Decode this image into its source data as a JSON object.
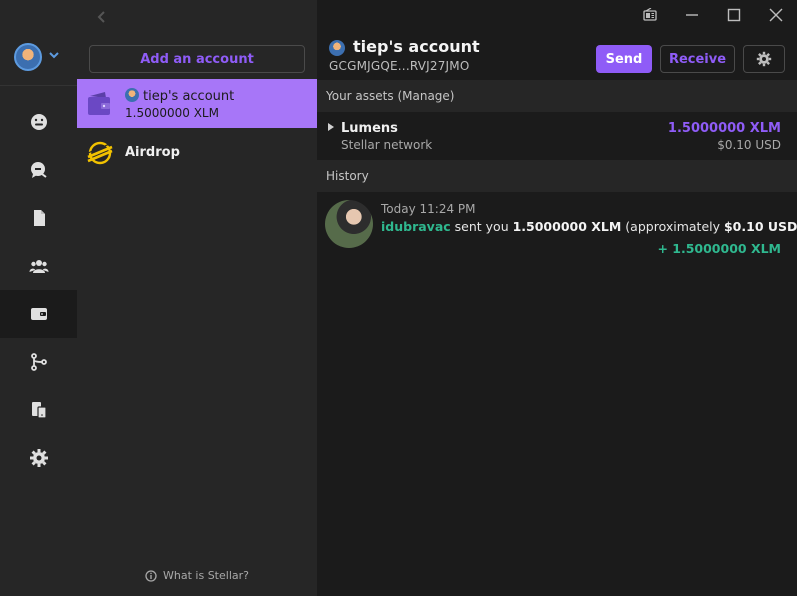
{
  "accounts_panel": {
    "add_button_label": "Add an account",
    "selected_account": {
      "name": "tiep's account",
      "balance": "1.5000000 XLM"
    },
    "airdrop_label": "Airdrop",
    "what_is_stellar": "What is Stellar?"
  },
  "header": {
    "title": "tiep's account",
    "address": "GCGMJGQE...RVJ27JMO",
    "send_label": "Send",
    "receive_label": "Receive"
  },
  "assets": {
    "section_label": "Your assets (Manage)",
    "items": [
      {
        "name": "Lumens",
        "network": "Stellar network",
        "amount": "1.5000000 XLM",
        "usd": "$0.10 USD"
      }
    ]
  },
  "history": {
    "section_label": "History",
    "items": [
      {
        "time": "Today 11:24 PM",
        "user": "idubravac",
        "text_sent": " sent you ",
        "amount": "1.5000000 XLM",
        "text_approx": " (approximately ",
        "usd": "$0.10 USD",
        "text_end": ").",
        "delta": "+ 1.5000000 XLM"
      }
    ]
  },
  "colors": {
    "accent": "#8f5cf7",
    "selected_bg": "#a776f8",
    "positive": "#2fb88f"
  }
}
